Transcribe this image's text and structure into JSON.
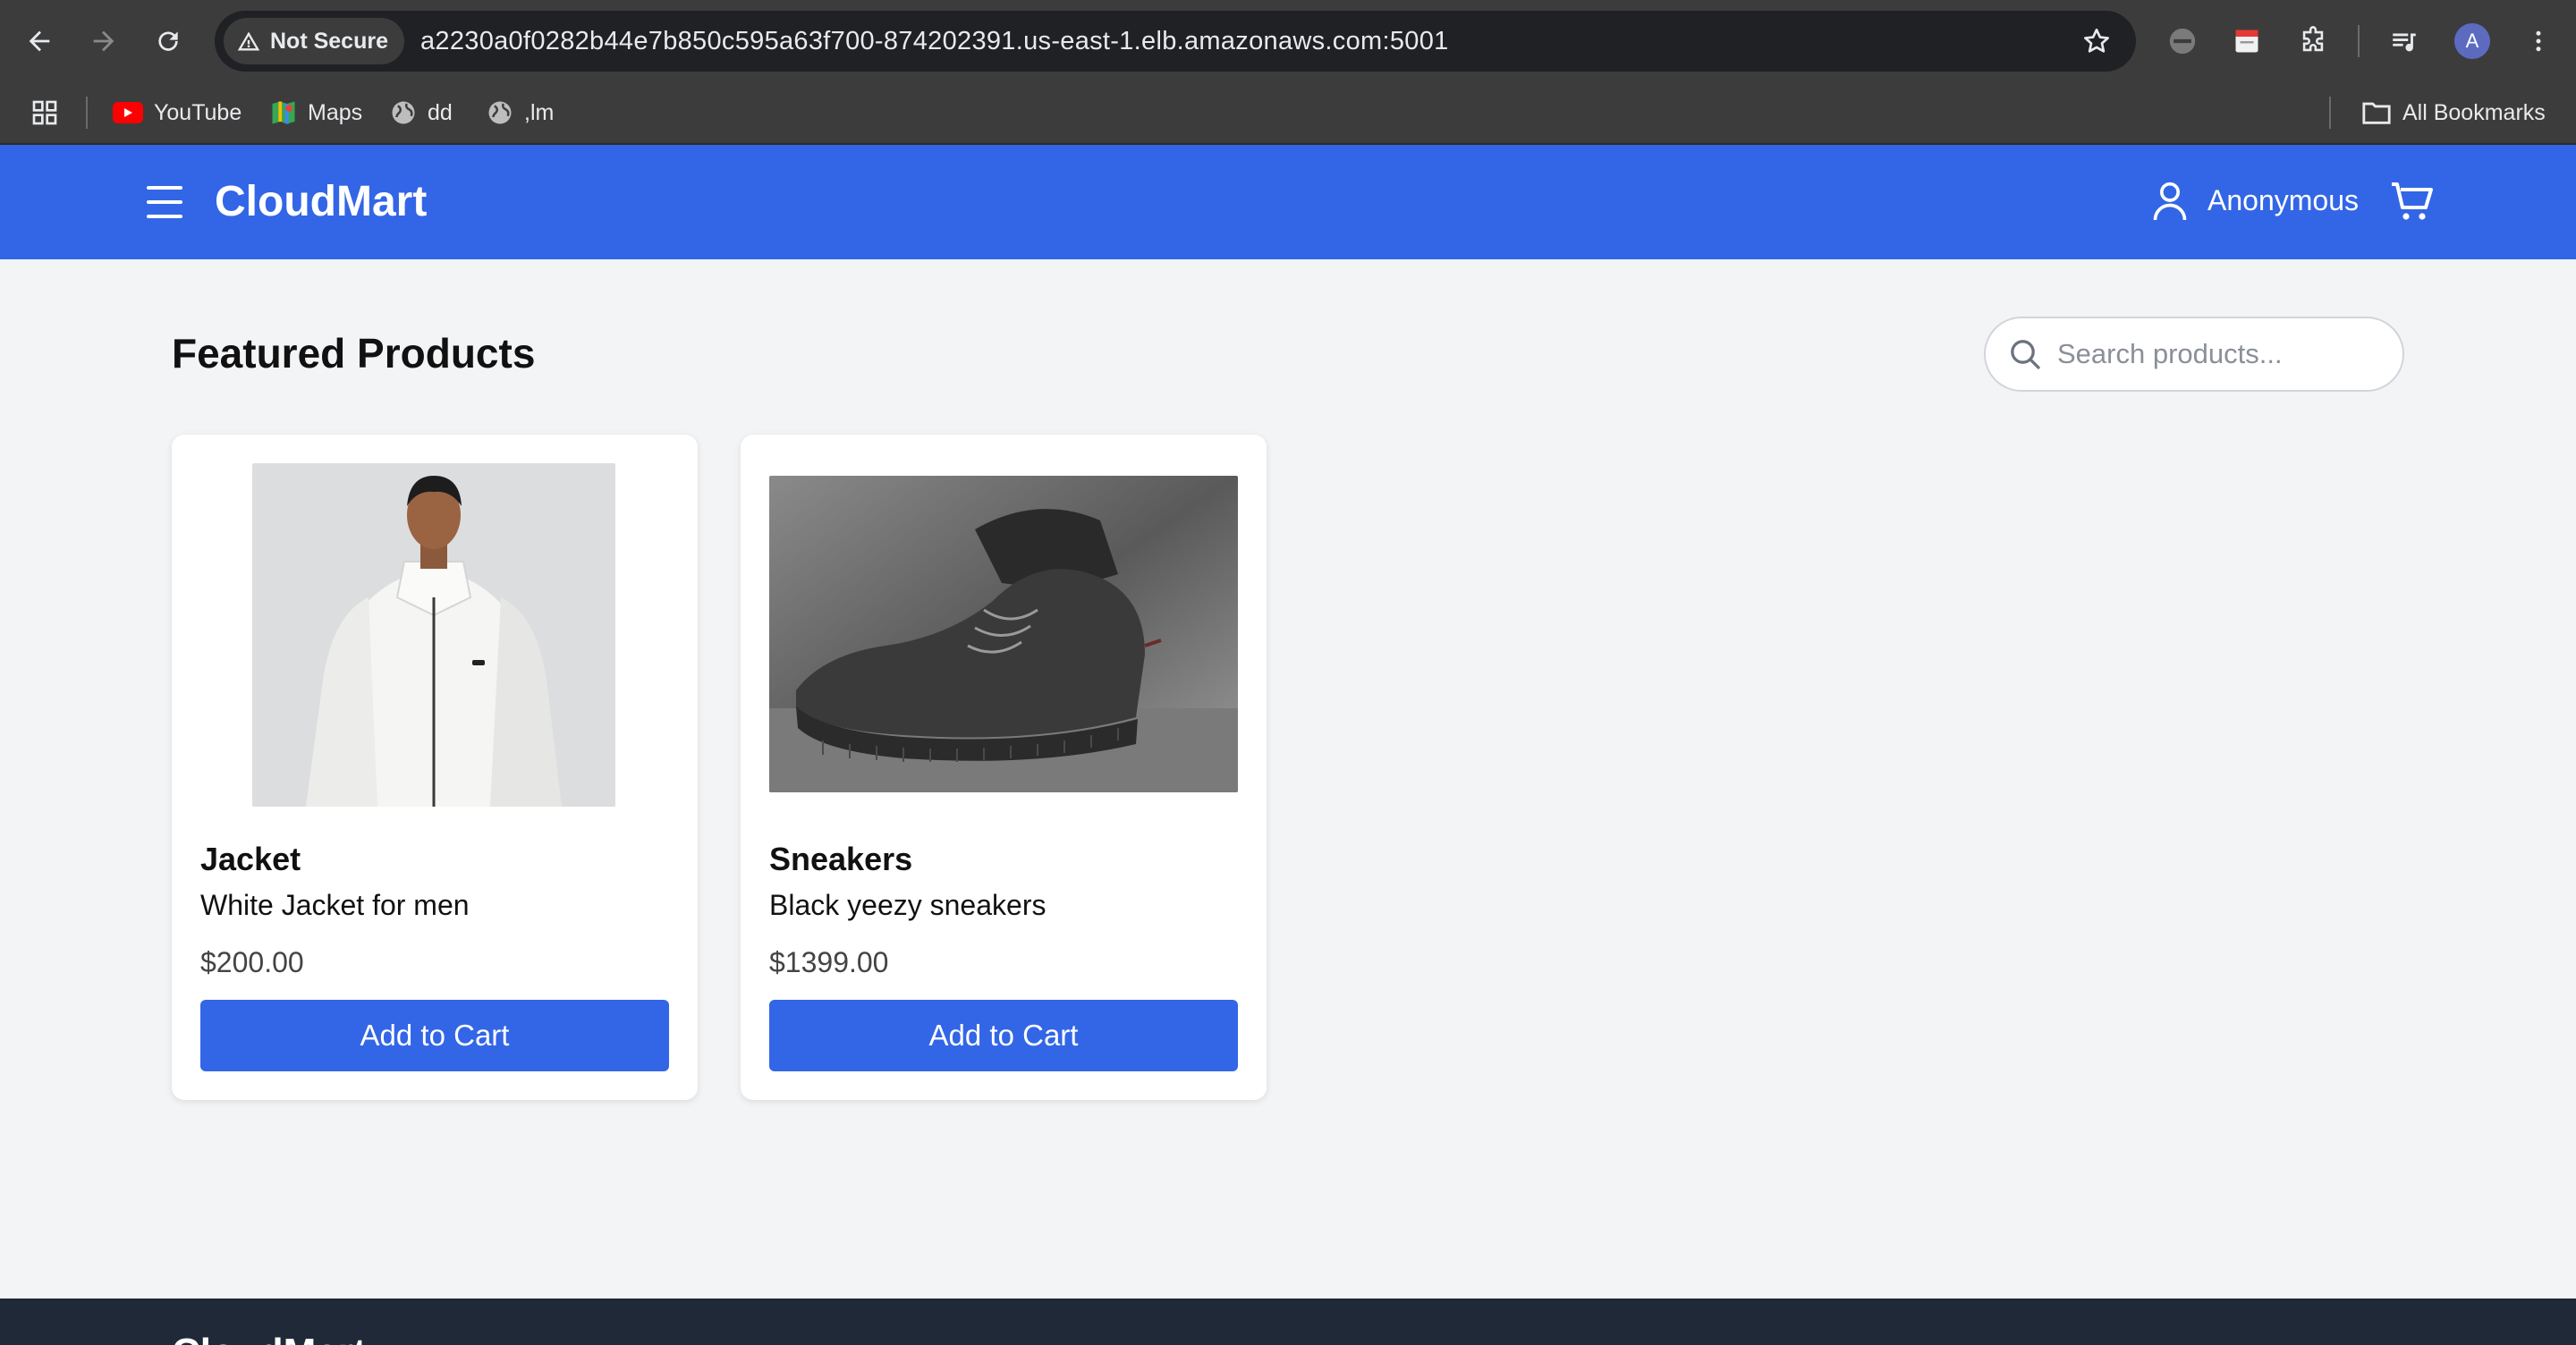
{
  "browser": {
    "security_label": "Not Secure",
    "url": "a2230a0f0282b44e7b850c595a63f700-874202391.us-east-1.elb.amazonaws.com:5001",
    "profile_initial": "A",
    "bookmarks": [
      {
        "label": "YouTube",
        "icon": "youtube-icon"
      },
      {
        "label": "Maps",
        "icon": "maps-icon"
      },
      {
        "label": "dd",
        "icon": "globe-icon"
      },
      {
        "label": ",lm",
        "icon": "globe-icon"
      }
    ],
    "all_bookmarks_label": "All Bookmarks"
  },
  "header": {
    "brand": "CloudMart",
    "user_name": "Anonymous"
  },
  "main": {
    "title": "Featured Products",
    "search_placeholder": "Search products..."
  },
  "products": [
    {
      "name": "Jacket",
      "description": "White Jacket for men",
      "price": "$200.00",
      "button_label": "Add to Cart"
    },
    {
      "name": "Sneakers",
      "description": "Black yeezy sneakers",
      "price": "$1399.00",
      "button_label": "Add to Cart"
    }
  ],
  "footer": {
    "brand": "CloudMart"
  },
  "colors": {
    "primary": "#3366e6",
    "chrome_bg": "#3c3c3c",
    "footer_bg": "#1f2937",
    "page_bg": "#f3f4f6"
  }
}
